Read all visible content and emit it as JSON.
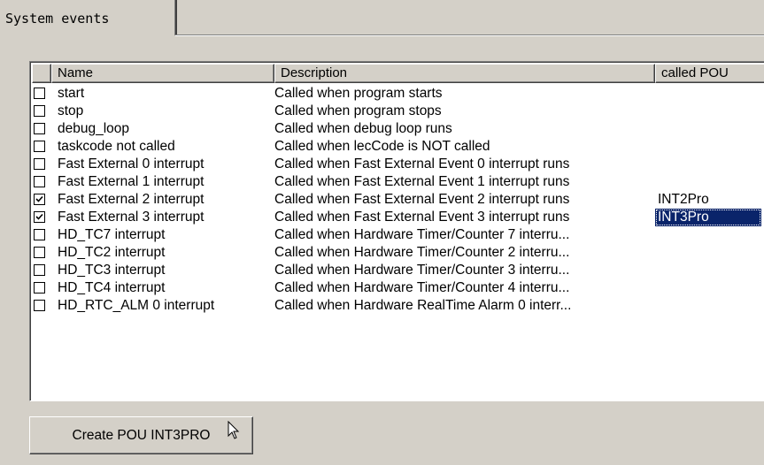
{
  "tab": {
    "label": "System events"
  },
  "columns": {
    "name": "Name",
    "description": "Description",
    "pou": "called POU"
  },
  "events": [
    {
      "checked": false,
      "name": "start",
      "description": "Called when program starts",
      "pou": ""
    },
    {
      "checked": false,
      "name": "stop",
      "description": "Called when program stops",
      "pou": ""
    },
    {
      "checked": false,
      "name": "debug_loop",
      "description": "Called when debug loop runs",
      "pou": ""
    },
    {
      "checked": false,
      "name": "taskcode not called",
      "description": "Called when lecCode is NOT called",
      "pou": ""
    },
    {
      "checked": false,
      "name": "Fast External 0 interrupt",
      "description": "Called when Fast External Event 0 interrupt runs",
      "pou": ""
    },
    {
      "checked": false,
      "name": "Fast External 1 interrupt",
      "description": "Called when Fast External Event 1 interrupt runs",
      "pou": ""
    },
    {
      "checked": true,
      "name": "Fast External 2 interrupt",
      "description": "Called when Fast External Event 2 interrupt runs",
      "pou": "INT2Pro"
    },
    {
      "checked": true,
      "name": "Fast External 3 interrupt",
      "description": "Called when Fast External Event 3 interrupt runs",
      "pou": "INT3Pro",
      "selected": true
    },
    {
      "checked": false,
      "name": "HD_TC7 interrupt",
      "description": "Called when Hardware Timer/Counter 7 interru...",
      "pou": ""
    },
    {
      "checked": false,
      "name": "HD_TC2 interrupt",
      "description": "Called when Hardware Timer/Counter 2 interru...",
      "pou": ""
    },
    {
      "checked": false,
      "name": "HD_TC3 interrupt",
      "description": "Called when Hardware Timer/Counter 3 interru...",
      "pou": ""
    },
    {
      "checked": false,
      "name": "HD_TC4 interrupt",
      "description": "Called when Hardware Timer/Counter 4 interru...",
      "pou": ""
    },
    {
      "checked": false,
      "name": "HD_RTC_ALM 0 interrupt",
      "description": "Called when Hardware RealTime Alarm 0 interr...",
      "pou": ""
    }
  ],
  "button": {
    "label": "Create POU INT3PRO"
  },
  "cursor": {
    "icon": "arrow-cursor-icon"
  },
  "colors": {
    "selection": "#0a246a",
    "face": "#d4d0c8"
  }
}
